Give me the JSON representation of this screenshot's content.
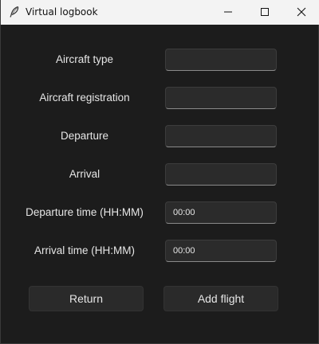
{
  "window": {
    "title": "Virtual logbook",
    "icon": "feather-icon",
    "controls": [
      "minimize-icon",
      "maximize-icon",
      "close-icon"
    ]
  },
  "form": {
    "fields": [
      {
        "label": "Aircraft type",
        "value": ""
      },
      {
        "label": "Aircraft registration",
        "value": ""
      },
      {
        "label": "Departure",
        "value": ""
      },
      {
        "label": "Arrival",
        "value": ""
      },
      {
        "label": "Departure time (HH:MM)",
        "value": "00:00"
      },
      {
        "label": "Arrival time (HH:MM)",
        "value": "00:00"
      }
    ]
  },
  "buttons": {
    "return_label": "Return",
    "add_label": "Add flight"
  },
  "colors": {
    "background": "#1c1c1c",
    "titlebar": "#f3f3f3",
    "field": "#2b2b2b",
    "text": "#e6e6e6"
  }
}
